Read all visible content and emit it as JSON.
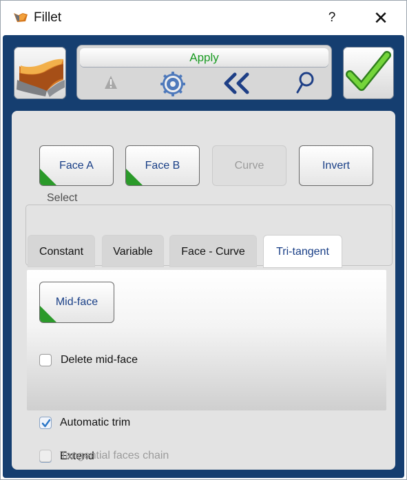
{
  "window": {
    "title": "Fillet",
    "help_label": "?",
    "close_label": "✕"
  },
  "toolbar": {
    "apply_label": "Apply",
    "icons": [
      "fillet-shape-icon",
      "warning-icon",
      "gear-icon",
      "double-chevron-left-icon",
      "search-icon",
      "checkmark-icon"
    ]
  },
  "select_group": {
    "label": "Select",
    "buttons": [
      "Face A",
      "Face B",
      "Curve",
      "Invert"
    ]
  },
  "tabs": [
    "Constant",
    "Variable",
    "Face - Curve",
    "Tri-tangent"
  ],
  "tri_tangent": {
    "mid_face_button": "Mid-face",
    "delete_mid_face_label": "Delete mid-face",
    "delete_mid_face_checked": false
  },
  "options": {
    "automatic_trim_label": "Automatic trim",
    "automatic_trim_checked": true,
    "extend_label": "Extend",
    "extend_checked": true,
    "tangential_faces_chain_label": "Tangential faces chain",
    "tangential_faces_chain_checked": false
  },
  "colors": {
    "frame": "#153e70",
    "apply_text": "#1a9b22",
    "button_text": "#183e86",
    "green_corner": "#2b9a2a",
    "check_blue": "#2d78c8"
  }
}
